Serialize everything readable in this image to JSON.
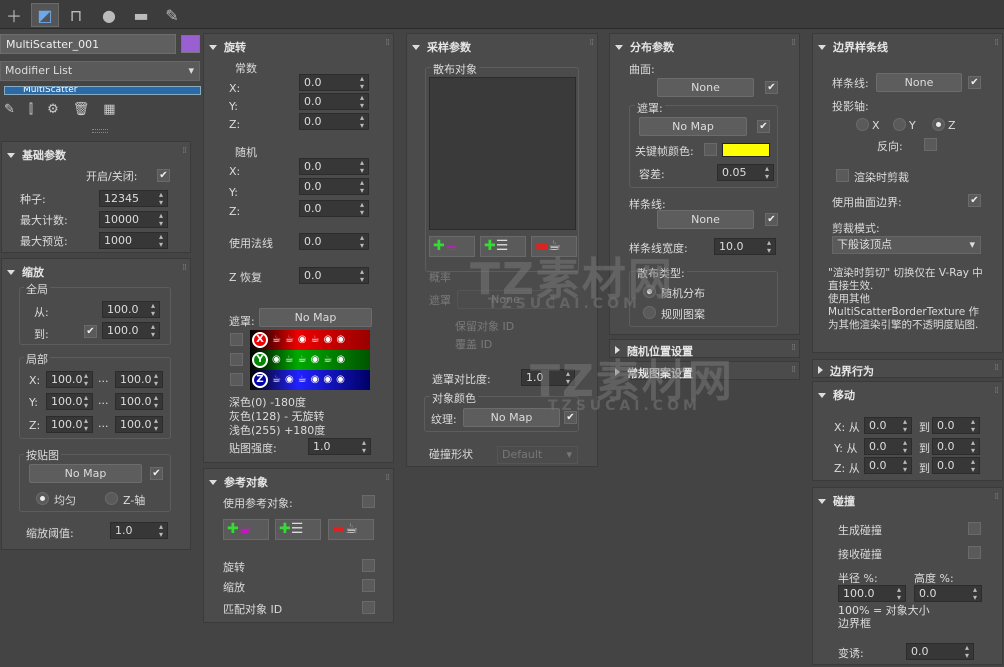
{
  "tabs": [
    {
      "icon": "create-plus-icon"
    },
    {
      "icon": "modify-icon"
    },
    {
      "icon": "hierarchy-icon"
    },
    {
      "icon": "motion-icon"
    },
    {
      "icon": "display-icon"
    },
    {
      "icon": "utilities-wrench-icon"
    }
  ],
  "object": {
    "name": "MultiScatter_001",
    "color": "#9a5fd0",
    "modifier_list": "Modifier List",
    "stack_item": "MultiScatter"
  },
  "basic": {
    "title": "基础参数",
    "enable_label": "开启/关闭:",
    "seed_label": "种子:",
    "seed": "12345",
    "max_count_label": "最大计数:",
    "max_count": "10000",
    "max_preview_label": "最大预览:",
    "max_preview": "1000"
  },
  "scale": {
    "title": "缩放",
    "global_label": "全局",
    "from_label": "从:",
    "from": "100.0",
    "to_label": "到:",
    "to": "100.0",
    "local_label": "局部",
    "x_label": "X:",
    "x_from": "100.0",
    "x_to": "100.0",
    "y_label": "Y:",
    "y_from": "100.0",
    "y_to": "100.0",
    "z_label": "Z:",
    "z_from": "100.0",
    "z_to": "100.0",
    "ellipsis": "...",
    "map_label": "按贴图",
    "map_button": "No Map",
    "uniform_label": "均匀",
    "zaxis_label": "Z-轴",
    "threshold_label": "缩放阈值:",
    "threshold": "1.0"
  },
  "rotation": {
    "title": "旋转",
    "constant_label": "常数",
    "x_label": "X:",
    "y_label": "Y:",
    "z_label": "Z:",
    "const_x": "0.0",
    "const_y": "0.0",
    "const_z": "0.0",
    "random_label": "随机",
    "rand_x": "0.0",
    "rand_y": "0.0",
    "rand_z": "0.0",
    "normal_label": "使用法线",
    "normal": "0.0",
    "zrestore_label": "Z 恢复",
    "zrestore": "0.0",
    "mask_label": "遮罩:",
    "mask_button": "No Map",
    "axis_x": "X",
    "axis_y": "Y",
    "axis_z": "Z",
    "legend_dark": "深色(0)   -180度",
    "legend_gray": "灰色(128) - 无旋转",
    "legend_light": "浅色(255)  +180度",
    "strength_label": "贴图强度:",
    "strength": "1.0"
  },
  "reference": {
    "title": "参考对象",
    "use_label": "使用参考对象:",
    "rotate_label": "旋转",
    "scale_label": "缩放",
    "match_label": "匹配对象 ID"
  },
  "sampling": {
    "title": "采样参数",
    "distrib_label": "散布对象",
    "prob_label": "概率",
    "mask_label": "遮罩",
    "mask_button": "None",
    "keep_id_label": "保留对象 ID",
    "override_label": "覆盖 ID",
    "mask_contrast_label": "遮罩对比度:",
    "mask_contrast": "1.0",
    "obj_color_label": "对象颜色",
    "texture_label": "纹理:",
    "texture_button": "No Map",
    "collision_label": "碰撞形状",
    "collision": "Default"
  },
  "distribution": {
    "title": "分布参数",
    "surface_label": "曲面:",
    "surface_button": "None",
    "mask_label": "遮罩:",
    "mask_button": "No Map",
    "keycolor_label": "关键帧颜色:",
    "keycolor": "#ffff00",
    "tolerance_label": "容差:",
    "tolerance": "0.05",
    "spline_label": "样条线:",
    "spline_button": "None",
    "spline_width_label": "样条线宽度:",
    "spline_width": "10.0",
    "scatter_type_label": "散布类型:",
    "random_label": "随机分布",
    "regular_label": "规则图案"
  },
  "random_pos": {
    "title": "随机位置设置"
  },
  "regular_pattern": {
    "title": "常规图案设置"
  },
  "border": {
    "title": "边界样条线",
    "spline_label": "样条线:",
    "spline_button": "None",
    "proj_label": "投影轴:",
    "x": "X",
    "y": "Y",
    "z": "Z",
    "reverse_label": "反向:",
    "render_clip_label": "渲染时剪裁",
    "use_surface_label": "使用曲面边界:",
    "clip_mode_label": "剪裁模式:",
    "clip_mode": "下般该顶点",
    "note": "\"渲染时剪切\" 切换仅在 V-Ray 中直接生效.\n使用其他 MultiScatterBorderTexture 作为其他渲染引擎的不透明度贴图."
  },
  "border_behavior": {
    "title": "边界行为"
  },
  "move": {
    "title": "移动",
    "x_label": "X: 从",
    "y_label": "Y: 从",
    "z_label": "Z: 从",
    "to_label": "到",
    "x_from": "0.0",
    "x_to": "0.0",
    "y_from": "0.0",
    "y_to": "0.0",
    "z_from": "0.0",
    "z_to": "0.0"
  },
  "collision": {
    "title": "碰撞",
    "generate_label": "生成碰撞",
    "receive_label": "接收碰撞",
    "radius_label": "半径 %:",
    "radius": "100.0",
    "height_label": "高度 %:",
    "height": "0.0",
    "note": "100% = 对象大小\n边界框",
    "variance_label": "变诱:",
    "variance": "0.0"
  },
  "watermark": {
    "text": "TZ素材网",
    "sub": "TZSUCAI.COM"
  }
}
